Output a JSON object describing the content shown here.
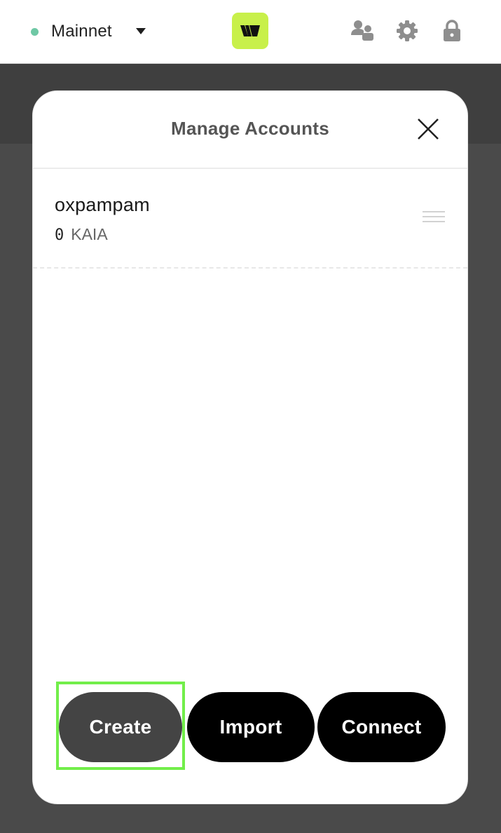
{
  "topbar": {
    "network_label": "Mainnet",
    "network_status_color": "#6fc8a5",
    "logo_color": "#c8f04a",
    "icons": [
      "accounts-icon",
      "gear-icon",
      "lock-icon"
    ]
  },
  "modal": {
    "title": "Manage Accounts",
    "accounts": [
      {
        "name": "oxpampam",
        "balance_amount": "0",
        "balance_unit": "KAIA"
      }
    ],
    "buttons": {
      "create": "Create",
      "import": "Import",
      "connect": "Connect"
    },
    "highlight_color": "#72ee4a"
  }
}
